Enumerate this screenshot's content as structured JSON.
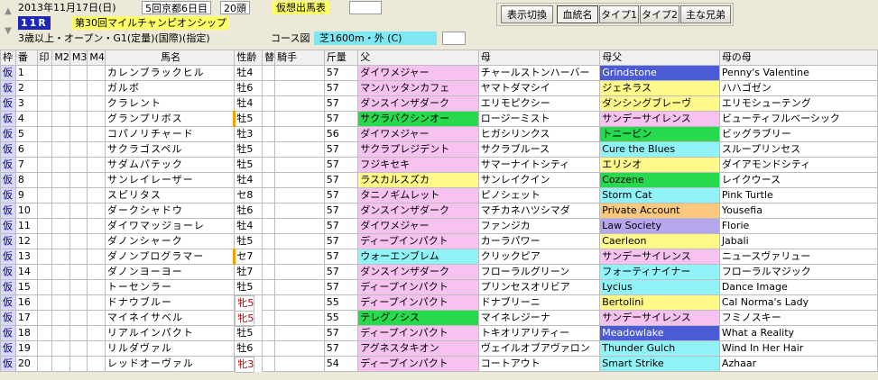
{
  "header": {
    "date": "2013年11月17日(日)",
    "meeting": "5回京都6日目",
    "runners": "20頭",
    "mode_button": "仮想出馬表",
    "race_no": "11R",
    "race_name": "第30回マイルチャンピオンシップ",
    "conditions": "3歳以上・オープン・G1(定量)(国際)(指定)",
    "course_label": "コース図",
    "course": "芝1600m・外 (C)"
  },
  "toolbar": {
    "toggle_label": "表示切換",
    "buttons": [
      "血統名",
      "タイプ1",
      "タイプ2",
      "主な兄弟"
    ],
    "active": 0
  },
  "columns": {
    "waku": "枠",
    "ban": "番",
    "mark": "印",
    "m2": "M2",
    "m3": "M3",
    "m4": "M4",
    "name": "馬名",
    "sexage": "性齢",
    "kae": "替",
    "jockey": "騎手",
    "weight": "斤量",
    "sire": "父",
    "dam": "母",
    "bms": "母父",
    "damdam": "母の母"
  },
  "colors": {
    "pink": "#f7c1f0",
    "green": "#27d94d",
    "yellow": "#fff98c",
    "cyan": "#8ff3f7",
    "blue": "#4c5bd6",
    "orange": "#fbc87e",
    "lavender": "#b6a6ee"
  },
  "rows": [
    {
      "waku": "仮",
      "ban": "1",
      "name": "カレンブラックヒル",
      "sexage": "牡4",
      "weight": "57",
      "sire": "ダイワメジャー",
      "dam": "チャールストンハーバー",
      "bms": "Grindstone",
      "damdam": "Penny's Valentine",
      "sire_bg": "pink",
      "bms_bg": "blue",
      "female": false,
      "mark": false
    },
    {
      "waku": "仮",
      "ban": "2",
      "name": "ガルボ",
      "sexage": "牡6",
      "weight": "57",
      "sire": "マンハッタンカフェ",
      "dam": "ヤマトダマシイ",
      "bms": "ジェネラス",
      "damdam": "ハハゴゼン",
      "sire_bg": "pink",
      "bms_bg": "yellow",
      "female": false,
      "mark": false
    },
    {
      "waku": "仮",
      "ban": "3",
      "name": "クラレント",
      "sexage": "牡4",
      "weight": "57",
      "sire": "ダンスインザダーク",
      "dam": "エリモピクシー",
      "bms": "ダンシングブレーヴ",
      "damdam": "エリモシューテング",
      "sire_bg": "pink",
      "bms_bg": "yellow",
      "female": false,
      "mark": false
    },
    {
      "waku": "仮",
      "ban": "4",
      "name": "グランプリボス",
      "sexage": "牡5",
      "weight": "57",
      "sire": "サクラバクシンオー",
      "dam": "ロージーミスト",
      "bms": "サンデーサイレンス",
      "damdam": "ビューティフルベーシック",
      "sire_bg": "green",
      "bms_bg": "pink",
      "female": false,
      "mark": true
    },
    {
      "waku": "仮",
      "ban": "5",
      "name": "コパノリチャード",
      "sexage": "牡3",
      "weight": "56",
      "sire": "ダイワメジャー",
      "dam": "ヒガシリンクス",
      "bms": "トニービン",
      "damdam": "ビッグラブリー",
      "sire_bg": "pink",
      "bms_bg": "green",
      "female": false,
      "mark": false
    },
    {
      "waku": "仮",
      "ban": "6",
      "name": "サクラゴスペル",
      "sexage": "牡5",
      "weight": "57",
      "sire": "サクラプレジデント",
      "dam": "サクラブルース",
      "bms": "Cure the Blues",
      "damdam": "スループリンセス",
      "sire_bg": "pink",
      "bms_bg": "cyan",
      "female": false,
      "mark": false
    },
    {
      "waku": "仮",
      "ban": "7",
      "name": "サダムパテック",
      "sexage": "牡5",
      "weight": "57",
      "sire": "フジキセキ",
      "dam": "サマーナイトシティ",
      "bms": "エリシオ",
      "damdam": "ダイアモンドシティ",
      "sire_bg": "pink",
      "bms_bg": "yellow",
      "female": false,
      "mark": false
    },
    {
      "waku": "仮",
      "ban": "8",
      "name": "サンレイレーザー",
      "sexage": "牡4",
      "weight": "57",
      "sire": "ラスカルスズカ",
      "dam": "サンレイクイン",
      "bms": "Cozzene",
      "damdam": "レイクウース",
      "sire_bg": "yellow",
      "bms_bg": "green",
      "female": false,
      "mark": false
    },
    {
      "waku": "仮",
      "ban": "9",
      "name": "スピリタス",
      "sexage": "セ8",
      "weight": "57",
      "sire": "タニノギムレット",
      "dam": "ピノシェット",
      "bms": "Storm Cat",
      "damdam": "Pink Turtle",
      "sire_bg": "pink",
      "bms_bg": "cyan",
      "female": false,
      "mark": false
    },
    {
      "waku": "仮",
      "ban": "10",
      "name": "ダークシャドウ",
      "sexage": "牡6",
      "weight": "57",
      "sire": "ダンスインザダーク",
      "dam": "マチカネハツシマダ",
      "bms": "Private Account",
      "damdam": "Yousefia",
      "sire_bg": "pink",
      "bms_bg": "orange",
      "female": false,
      "mark": false
    },
    {
      "waku": "仮",
      "ban": "11",
      "name": "ダイワマッジョーレ",
      "sexage": "牡4",
      "weight": "57",
      "sire": "ダイワメジャー",
      "dam": "ファンジカ",
      "bms": "Law Society",
      "damdam": "Florie",
      "sire_bg": "pink",
      "bms_bg": "lavender",
      "female": false,
      "mark": false
    },
    {
      "waku": "仮",
      "ban": "12",
      "name": "ダノンシャーク",
      "sexage": "牡5",
      "weight": "57",
      "sire": "ディープインパクト",
      "dam": "カーラパワー",
      "bms": "Caerleon",
      "damdam": "Jabali",
      "sire_bg": "pink",
      "bms_bg": "yellow",
      "female": false,
      "mark": false
    },
    {
      "waku": "仮",
      "ban": "13",
      "name": "ダノンプログラマー",
      "sexage": "セ7",
      "weight": "57",
      "sire": "ウォーエンブレム",
      "dam": "クリックピア",
      "bms": "サンデーサイレンス",
      "damdam": "ニュースヴァリュー",
      "sire_bg": "cyan",
      "bms_bg": "pink",
      "female": false,
      "mark": true
    },
    {
      "waku": "仮",
      "ban": "14",
      "name": "ダノンヨーヨー",
      "sexage": "牡7",
      "weight": "57",
      "sire": "ダンスインザダーク",
      "dam": "フローラルグリーン",
      "bms": "フォーティナイナー",
      "damdam": "フローラルマジック",
      "sire_bg": "pink",
      "bms_bg": "cyan",
      "female": false,
      "mark": false
    },
    {
      "waku": "仮",
      "ban": "15",
      "name": "トーセンラー",
      "sexage": "牡5",
      "weight": "57",
      "sire": "ディープインパクト",
      "dam": "プリンセスオリビア",
      "bms": "Lycius",
      "damdam": "Dance Image",
      "sire_bg": "pink",
      "bms_bg": "cyan",
      "female": false,
      "mark": false
    },
    {
      "waku": "仮",
      "ban": "16",
      "name": "ドナウブルー",
      "sexage": "牝5",
      "weight": "55",
      "sire": "ディープインパクト",
      "dam": "ドナブリーニ",
      "bms": "Bertolini",
      "damdam": "Cal Norma's Lady",
      "sire_bg": "pink",
      "bms_bg": "yellow",
      "female": true,
      "mark": false
    },
    {
      "waku": "仮",
      "ban": "17",
      "name": "マイネイサベル",
      "sexage": "牝5",
      "weight": "55",
      "sire": "テレグノシス",
      "dam": "マイネレジーナ",
      "bms": "サンデーサイレンス",
      "damdam": "フミノスキー",
      "sire_bg": "green",
      "bms_bg": "pink",
      "female": true,
      "mark": false
    },
    {
      "waku": "仮",
      "ban": "18",
      "name": "リアルインパクト",
      "sexage": "牡5",
      "weight": "57",
      "sire": "ディープインパクト",
      "dam": "トキオリアリティー",
      "bms": "Meadowlake",
      "damdam": "What a Reality",
      "sire_bg": "pink",
      "bms_bg": "blue",
      "female": false,
      "mark": false
    },
    {
      "waku": "仮",
      "ban": "19",
      "name": "リルダヴァル",
      "sexage": "牡6",
      "weight": "57",
      "sire": "アグネスタキオン",
      "dam": "ヴェイルオブアヴァロン",
      "bms": "Thunder Gulch",
      "damdam": "Wind In Her Hair",
      "sire_bg": "pink",
      "bms_bg": "cyan",
      "female": false,
      "mark": false
    },
    {
      "waku": "仮",
      "ban": "20",
      "name": "レッドオーヴァル",
      "sexage": "牝3",
      "weight": "54",
      "sire": "ディープインパクト",
      "dam": "コートアウト",
      "bms": "Smart Strike",
      "damdam": "Azhaar",
      "sire_bg": "pink",
      "bms_bg": "cyan",
      "female": true,
      "mark": false
    }
  ]
}
